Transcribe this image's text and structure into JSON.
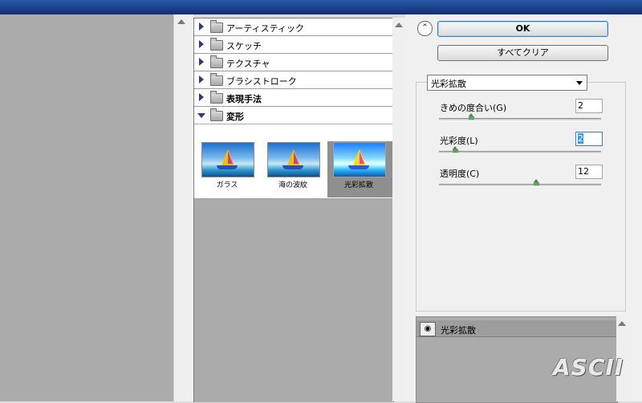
{
  "categories": [
    {
      "label": "アーティスティック",
      "expanded": false
    },
    {
      "label": "スケッチ",
      "expanded": false
    },
    {
      "label": "テクスチャ",
      "expanded": false
    },
    {
      "label": "ブラシストローク",
      "expanded": false
    },
    {
      "label": "表現手法",
      "expanded": false
    },
    {
      "label": "変形",
      "expanded": true
    }
  ],
  "filters": [
    {
      "label": "ガラス",
      "selected": false
    },
    {
      "label": "海の波紋",
      "selected": false
    },
    {
      "label": "光彩拡散",
      "selected": true
    }
  ],
  "buttons": {
    "ok": "OK",
    "clear_all": "すべてクリア"
  },
  "collapse_icon": "double-chevron-up-icon",
  "filter_select": {
    "value": "光彩拡散"
  },
  "params": [
    {
      "label": "きめの度合い(G)",
      "value": "2",
      "slider_fraction": 0.2
    },
    {
      "label": "光彩度(L)",
      "value": "2",
      "slider_fraction": 0.1,
      "focused": true
    },
    {
      "label": "透明度(C)",
      "value": "12",
      "slider_fraction": 0.6
    }
  ],
  "layers": [
    {
      "name": "光彩拡散",
      "visible": true
    }
  ],
  "watermark": "ASCII"
}
